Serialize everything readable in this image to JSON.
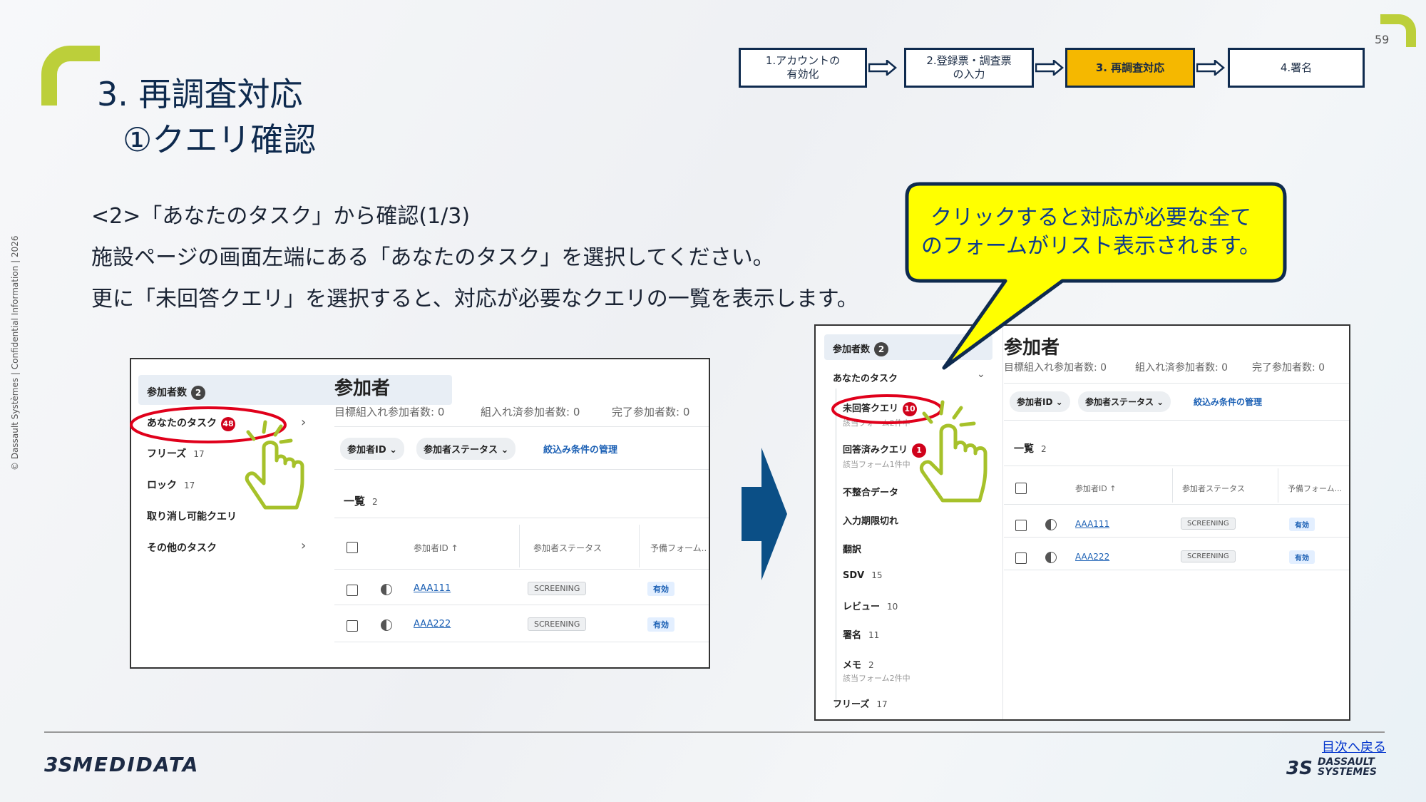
{
  "page_number": "59",
  "title_line1": "3. 再調査対応",
  "title_line2": "①クエリ確認",
  "confidential": "© Dassault Systèmes | Confidential Information | 2026",
  "steps": [
    {
      "label": "1.アカウントの\n有効化"
    },
    {
      "label": "2.登録票・調査票\nの入力"
    },
    {
      "label": "3. 再調査対応"
    },
    {
      "label": "4.署名"
    }
  ],
  "body": {
    "line1": "<2>「あなたのタスク」から確認(1/3)",
    "line2": "施設ページの画面左端にある「あなたのタスク」を選択してください。",
    "line3": "更に「未回答クエリ」を選択すると、対応が必要なクエリの一覧を表示します。"
  },
  "callout": "クリックすると対応が必要な全て\nのフォームがリスト表示されます。",
  "left_panel": {
    "sidebar": {
      "participants_label": "参加者数",
      "participants_badge": "2",
      "your_tasks_label": "あなたのタスク",
      "your_tasks_badge": "48",
      "freeze_label": "フリーズ",
      "freeze_count": "17",
      "lock_label": "ロック",
      "lock_count": "17",
      "cancelable_label": "取り消し可能クエリ",
      "other_tasks_label": "その他のタスク"
    },
    "header": {
      "title": "参加者",
      "stat1": "目標組入れ参加者数: 0",
      "stat2": "組入れ済参加者数: 0",
      "stat3": "完了参加者数: 0"
    },
    "filters": {
      "participant_id": "参加者ID ⌄",
      "participant_status": "参加者ステータス ⌄",
      "manage": "絞込み条件の管理"
    },
    "list": {
      "title": "一覧",
      "count": "2",
      "col_id": "参加者ID ↑",
      "col_status": "参加者ステータス",
      "col_form": "予備フォーム..",
      "rows": [
        {
          "id": "AAA111",
          "status": "SCREENING",
          "form": "有効"
        },
        {
          "id": "AAA222",
          "status": "SCREENING",
          "form": "有効"
        }
      ]
    }
  },
  "right_panel": {
    "sidebar": {
      "participants_label": "参加者数",
      "participants_badge": "2",
      "your_tasks_label": "あなたのタスク",
      "unanswered_label": "未回答クエリ",
      "unanswered_badge": "10",
      "unanswered_sub": "該当フォーム2件中",
      "answered_label": "回答済みクエリ",
      "answered_badge": "1",
      "answered_sub": "該当フォーム1件中",
      "mismatch_label": "不整合データ",
      "expired_label": "入力期限切れ",
      "translation_label": "翻訳",
      "sdv_label": "SDV",
      "sdv_count": "15",
      "review_label": "レビュー",
      "review_count": "10",
      "sign_label": "署名",
      "sign_count": "11",
      "memo_label": "メモ",
      "memo_count": "2",
      "memo_sub": "該当フォーム2件中",
      "freeze_label": "フリーズ",
      "freeze_count": "17"
    },
    "header": {
      "title": "参加者",
      "stat1": "目標組入れ参加者数: 0",
      "stat2": "組入れ済参加者数: 0",
      "stat3": "完了参加者数: 0"
    },
    "filters": {
      "participant_id": "参加者ID ⌄",
      "participant_status": "参加者ステータス ⌄",
      "manage": "絞込み条件の管理"
    },
    "list": {
      "title": "一覧",
      "count": "2",
      "col_id": "参加者ID ↑",
      "col_status": "参加者ステータス",
      "col_form": "予備フォーム...",
      "rows": [
        {
          "id": "AAA111",
          "status": "SCREENING",
          "form": "有効"
        },
        {
          "id": "AAA222",
          "status": "SCREENING",
          "form": "有効"
        }
      ]
    }
  },
  "footer": {
    "medidata_logo": "MEDIDATA",
    "toc_link": "目次へ戻る",
    "dassault_line1": "DASSAULT",
    "dassault_line2": "SYSTEMES"
  },
  "colors": {
    "accent_green": "#bccf3a",
    "navy": "#0f2b4f",
    "active_step": "#f5b800",
    "callout_yellow": "#ffff00",
    "highlight_red": "#e0001b",
    "hand_green": "#a6c12a",
    "arrow_blue": "#0b4f86"
  },
  "icons": [
    "hand-pointer-icon",
    "chevron-right-icon",
    "chevron-down-icon",
    "double-arrow-icon"
  ]
}
